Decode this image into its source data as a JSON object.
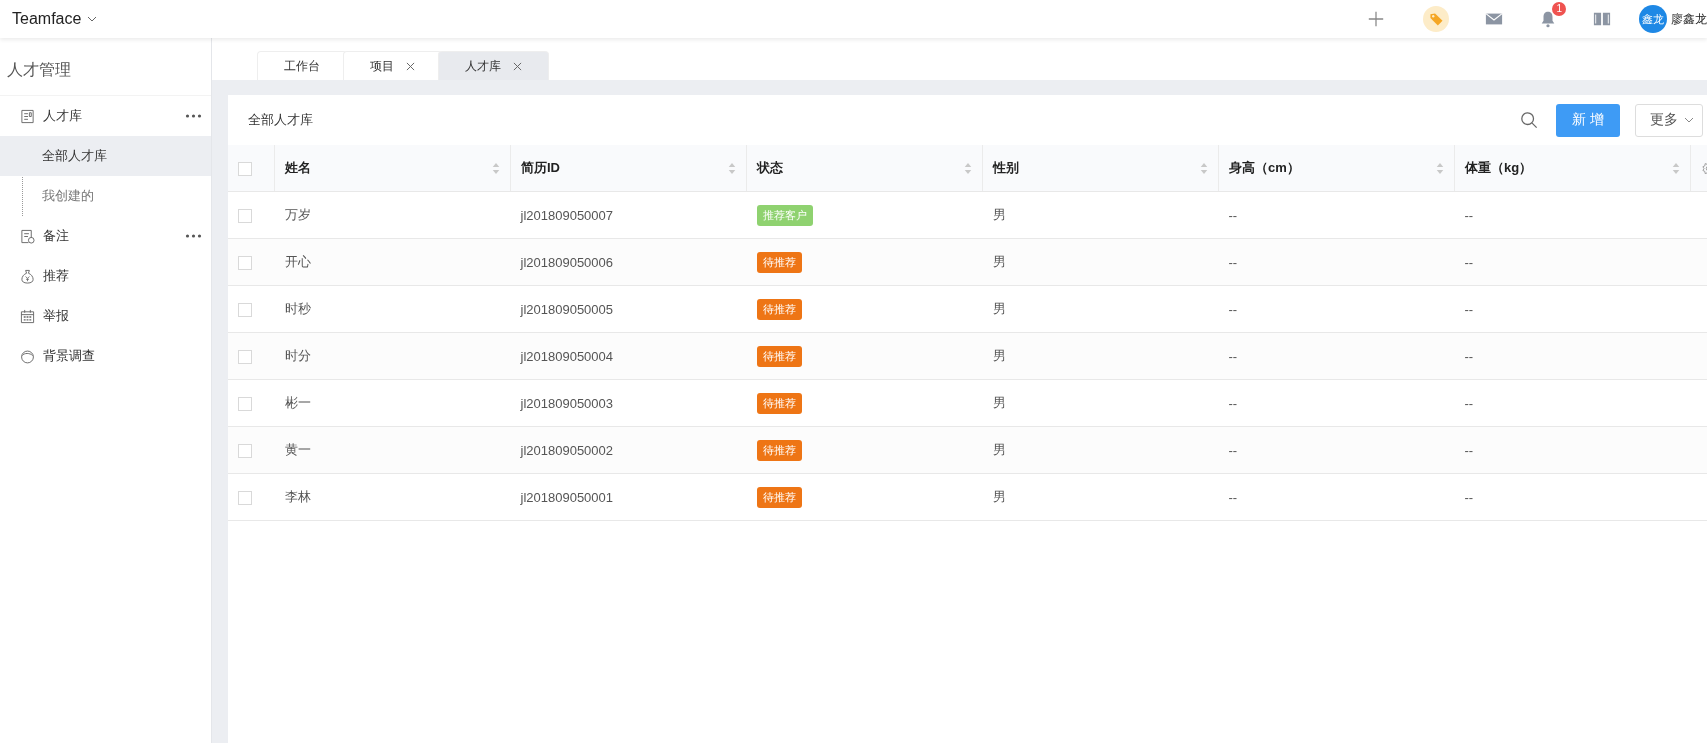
{
  "header": {
    "brand": "Teamface",
    "notification_count": "1",
    "avatar_text": "鑫龙",
    "user_name": "廖鑫龙"
  },
  "sidebar": {
    "title": "人才管理",
    "items": [
      {
        "label": "人才库",
        "kind": "list",
        "more_menu": true,
        "selected": false,
        "children": [
          {
            "label": "全部人才库",
            "selected": true
          },
          {
            "label": "我创建的",
            "selected": false
          }
        ]
      },
      {
        "label": "备注",
        "kind": "note",
        "more_menu": true,
        "selected": false
      },
      {
        "label": "推荐",
        "kind": "moneybag",
        "more_menu": false,
        "selected": false
      },
      {
        "label": "举报",
        "kind": "calendar",
        "more_menu": false,
        "selected": false
      },
      {
        "label": "背景调查",
        "kind": "person",
        "more_menu": false,
        "selected": false
      }
    ]
  },
  "tabs": [
    {
      "label": "工作台",
      "closable": false,
      "selected": false
    },
    {
      "label": "项目",
      "closable": true,
      "selected": false
    },
    {
      "label": "人才库",
      "closable": true,
      "selected": true
    }
  ],
  "toolbar": {
    "title": "全部人才库",
    "add_button": "新 增",
    "more_button": "更多"
  },
  "table": {
    "all_checked": false,
    "columns": [
      "姓名",
      "简历ID",
      "状态",
      "性别",
      "身高（cm）",
      "体重（kg）"
    ],
    "rows": [
      {
        "checked": false,
        "name": "万岁",
        "id": "jl201809050007",
        "status": {
          "label": "推荐客户",
          "color": "#8fd270"
        },
        "gender": "男",
        "height": "--",
        "weight": "--"
      },
      {
        "checked": false,
        "name": "开心",
        "id": "jl201809050006",
        "status": {
          "label": "待推荐",
          "color": "#ee7515"
        },
        "gender": "男",
        "height": "--",
        "weight": "--"
      },
      {
        "checked": false,
        "name": "时秒",
        "id": "jl201809050005",
        "status": {
          "label": "待推荐",
          "color": "#ee7515"
        },
        "gender": "男",
        "height": "--",
        "weight": "--"
      },
      {
        "checked": false,
        "name": "时分",
        "id": "jl201809050004",
        "status": {
          "label": "待推荐",
          "color": "#ee7515"
        },
        "gender": "男",
        "height": "--",
        "weight": "--"
      },
      {
        "checked": false,
        "name": "彬一",
        "id": "jl201809050003",
        "status": {
          "label": "待推荐",
          "color": "#ee7515"
        },
        "gender": "男",
        "height": "--",
        "weight": "--"
      },
      {
        "checked": false,
        "name": "黄一",
        "id": "jl201809050002",
        "status": {
          "label": "待推荐",
          "color": "#ee7515"
        },
        "gender": "男",
        "height": "--",
        "weight": "--"
      },
      {
        "checked": false,
        "name": "李林",
        "id": "jl201809050001",
        "status": {
          "label": "待推荐",
          "color": "#ee7515"
        },
        "gender": "男",
        "height": "--",
        "weight": "--"
      }
    ]
  }
}
